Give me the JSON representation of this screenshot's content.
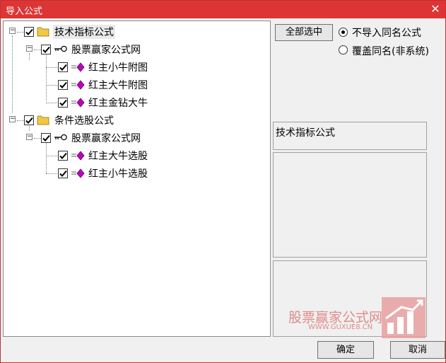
{
  "window": {
    "title": "导入公式",
    "close_glyph": "✕"
  },
  "tree": {
    "nodes": [
      {
        "label": "技术指标公式",
        "icon": "folder-icon"
      },
      {
        "label": "股票赢家公式网",
        "icon": "key-icon"
      },
      {
        "label": "红主小牛附图",
        "icon": "formula-icon"
      },
      {
        "label": "红主大牛附图",
        "icon": "formula-icon"
      },
      {
        "label": "红主金钻大牛",
        "icon": "formula-icon"
      },
      {
        "label": "条件选股公式",
        "icon": "folder-icon"
      },
      {
        "label": "股票赢家公式网",
        "icon": "key-icon"
      },
      {
        "label": "红主大牛选股",
        "icon": "formula-icon"
      },
      {
        "label": "红主小牛选股",
        "icon": "formula-icon"
      }
    ]
  },
  "options": {
    "select_all_label": "全部选中",
    "radio_no_import": "不导入同名公式",
    "radio_overwrite": "覆盖同名(非系统)",
    "selected": "no_import"
  },
  "description": {
    "text": "技术指标公式"
  },
  "watermark": {
    "name": "股票赢家公式网",
    "url": "WWW.GUXUE8.CN"
  },
  "footer": {
    "ok_label": "确定",
    "cancel_label": "取消"
  },
  "colors": {
    "title_bar": "#dd3535",
    "folder": "#f2c744",
    "formula_icon": "#c000c0"
  }
}
